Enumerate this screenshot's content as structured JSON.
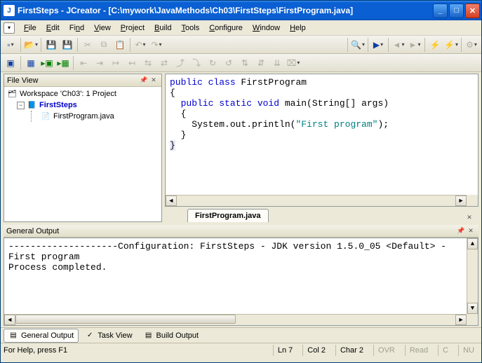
{
  "title": "FirstSteps - JCreator - [C:\\mywork\\JavaMethods\\Ch03\\FirstSteps\\FirstProgram.java]",
  "menu": {
    "file": "File",
    "edit": "Edit",
    "find": "Find",
    "view": "View",
    "project": "Project",
    "build": "Build",
    "tools": "Tools",
    "configure": "Configure",
    "window": "Window",
    "help": "Help"
  },
  "fileview": {
    "title": "File View",
    "workspace": "Workspace 'Ch03': 1 Project",
    "project": "FirstSteps",
    "file": "FirstProgram.java"
  },
  "editor": {
    "tab": "FirstProgram.java",
    "code": {
      "l1a": "public",
      "l1b": " class",
      "l1c": " FirstProgram",
      "l2": "{",
      "l3a": "  public",
      "l3b": " static",
      "l3c": " void",
      "l3d": " main(String[] args)",
      "l4": "  {",
      "l5a": "    System.out.println(",
      "l5b": "\"First program\"",
      "l5c": ");",
      "l6": "  }",
      "l7": "}"
    }
  },
  "output": {
    "title": "General Output",
    "l1": "--------------------Configuration: FirstSteps - JDK version 1.5.0_05 <Default> -",
    "l2": "First program",
    "l3": "",
    "l4": "Process completed.",
    "tabs": {
      "general": "General Output",
      "task": "Task View",
      "build": "Build Output"
    }
  },
  "status": {
    "help": "For Help, press F1",
    "ln": "Ln 7",
    "col": "Col 2",
    "char": "Char 2",
    "ovr": "OVR",
    "read": "Read",
    "cap": "C",
    "num": "NU"
  }
}
